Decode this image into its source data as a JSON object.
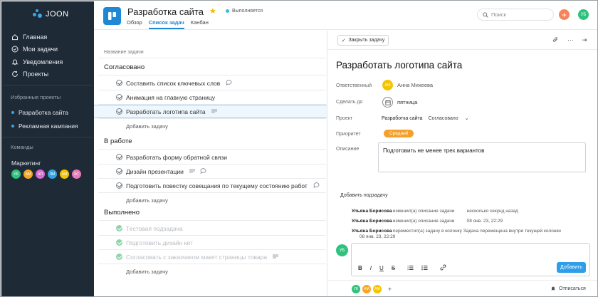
{
  "app": {
    "name": "JOON"
  },
  "sidebar": {
    "nav": [
      {
        "label": "Главная",
        "icon": "home-icon"
      },
      {
        "label": "Мои задачи",
        "icon": "check-circle-icon"
      },
      {
        "label": "Уведомления",
        "icon": "bell-icon"
      },
      {
        "label": "Проекты",
        "icon": "refresh-icon"
      }
    ],
    "favorites_heading": "Избранные проекты",
    "favorites": [
      {
        "label": "Разработка сайта"
      },
      {
        "label": "Рекламная кампания"
      }
    ],
    "teams_heading": "Команды",
    "team_name": "Маркетинг",
    "team_avatars": [
      {
        "initials": "УБ",
        "color": "#2ec27e"
      },
      {
        "initials": "АМ",
        "color": "#f5a623"
      },
      {
        "initials": "АП",
        "color": "#d96bd6"
      },
      {
        "initials": "ЛМ",
        "color": "#33a3e3"
      },
      {
        "initials": "АМ",
        "color": "#f5c400"
      },
      {
        "initials": "КС",
        "color": "#e87bb8"
      }
    ]
  },
  "header": {
    "title": "Разработка сайта",
    "status": "Выполняется",
    "tabs": [
      {
        "label": "Обзор",
        "active": false
      },
      {
        "label": "Список задач",
        "active": true
      },
      {
        "label": "Канбан",
        "active": false
      }
    ],
    "search_placeholder": "Поиск",
    "user_initials": "УБ"
  },
  "task_list": {
    "column_header": "Название задачи",
    "add_task_label": "Добавить задачу",
    "groups": [
      {
        "name": "Согласовано",
        "tasks": [
          {
            "name": "Составить список ключевых слов",
            "done": false,
            "icons": [
              "comment-icon"
            ]
          },
          {
            "name": "Анимация на главную страницу",
            "done": false,
            "icons": []
          },
          {
            "name": "Разработать логотипа сайта",
            "done": false,
            "icons": [
              "description-icon"
            ],
            "selected": true
          }
        ]
      },
      {
        "name": "В работе",
        "tasks": [
          {
            "name": "Разработать форму обратной связи",
            "done": false,
            "icons": []
          },
          {
            "name": "Дизайн презентации",
            "done": false,
            "icons": [
              "description-icon",
              "comment-icon"
            ]
          },
          {
            "name": "Подготовить повестку совещания по текущему состоянию работ",
            "done": false,
            "icons": [
              "comment-icon"
            ]
          }
        ]
      },
      {
        "name": "Выполнено",
        "tasks": [
          {
            "name": "Тестовая подзадача",
            "done": true,
            "icons": []
          },
          {
            "name": "Подготовить дизайн кит",
            "done": true,
            "icons": []
          },
          {
            "name": "Согласовать с заказчиком макет страницы товара",
            "done": true,
            "icons": [
              "description-icon"
            ]
          }
        ]
      }
    ]
  },
  "detail": {
    "close_label": "Закрыть задачу",
    "title": "Разработать логотипа сайта",
    "assignee_label": "Ответственный",
    "assignee_initials": "АМ",
    "assignee_name": "Анна Михеева",
    "due_label": "Сделать до",
    "due_value": "пятница",
    "project_label": "Проект",
    "project_value": "Разработка сайта",
    "project_section": "Согласовано",
    "priority_label": "Приоритет",
    "priority_value": "Средний",
    "priority_color": "#f5a02a",
    "description_label": "Описание",
    "description_value": "Подготовить не менее трех вариантов",
    "add_subtask_label": "Добавить подзадачу",
    "activity": [
      {
        "who": "Ульяна Борисова",
        "what": "изменил(а) описание задачи",
        "when": "несколько секунд назад"
      },
      {
        "who": "Ульяна Борисова",
        "what": "изменил(а) описание задачи",
        "when": "08 янв. 23, 22:29"
      },
      {
        "who": "Ульяна Борисова",
        "what": "переместил(а) задачу в колонку Задача перемещена внутри текущей колонки",
        "when": "08 янв. 23, 22:29"
      }
    ],
    "comment_avatar": "УБ",
    "format_buttons": [
      "B",
      "I",
      "U",
      "S"
    ],
    "send_label": "Добавить",
    "followers": [
      {
        "initials": "УБ",
        "color": "#2ec27e"
      },
      {
        "initials": "АМ",
        "color": "#f5a623"
      },
      {
        "initials": "АМ",
        "color": "#f5c400"
      }
    ],
    "unsubscribe_label": "Отписаться"
  }
}
